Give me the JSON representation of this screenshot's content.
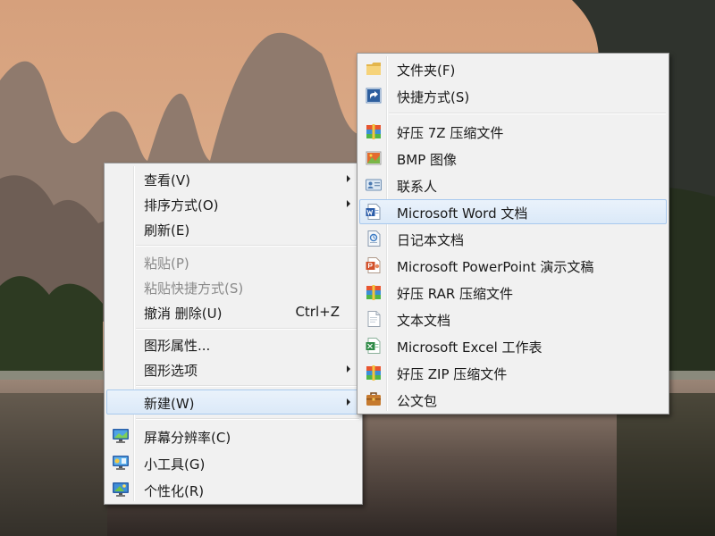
{
  "context_menu": {
    "items": [
      {
        "label": "查看(V)"
      },
      {
        "label": "排序方式(O)"
      },
      {
        "label": "刷新(E)"
      },
      {
        "label": "粘贴(P)"
      },
      {
        "label": "粘贴快捷方式(S)"
      },
      {
        "label": "撤消 删除(U)",
        "shortcut": "Ctrl+Z"
      },
      {
        "label": "图形属性..."
      },
      {
        "label": "图形选项"
      },
      {
        "label": "新建(W)"
      },
      {
        "label": "屏幕分辨率(C)",
        "icon": "display-icon"
      },
      {
        "label": "小工具(G)",
        "icon": "gadgets-icon"
      },
      {
        "label": "个性化(R)",
        "icon": "personalize-icon"
      }
    ]
  },
  "new_submenu": {
    "items": [
      {
        "label": "文件夹(F)",
        "icon": "folder-icon"
      },
      {
        "label": "快捷方式(S)",
        "icon": "shortcut-icon"
      },
      {
        "label": "好压 7Z 压缩文件",
        "icon": "haozip-archive-icon"
      },
      {
        "label": "BMP 图像",
        "icon": "bitmap-image-icon"
      },
      {
        "label": "联系人",
        "icon": "contact-icon"
      },
      {
        "label": "Microsoft Word 文档",
        "icon": "word-document-icon"
      },
      {
        "label": "日记本文档",
        "icon": "journal-document-icon"
      },
      {
        "label": "Microsoft PowerPoint 演示文稿",
        "icon": "powerpoint-document-icon"
      },
      {
        "label": "好压 RAR 压缩文件",
        "icon": "haozip-archive-icon"
      },
      {
        "label": "文本文档",
        "icon": "text-document-icon"
      },
      {
        "label": "Microsoft Excel 工作表",
        "icon": "excel-document-icon"
      },
      {
        "label": "好压 ZIP 压缩文件",
        "icon": "haozip-archive-icon"
      },
      {
        "label": "公文包",
        "icon": "briefcase-icon"
      }
    ]
  },
  "colors": {
    "menu_background": "#f1f1f1",
    "highlight_border": "#a8c9ee",
    "highlight_fill": "#dceaf9",
    "disabled_text": "#8a8a8a"
  }
}
